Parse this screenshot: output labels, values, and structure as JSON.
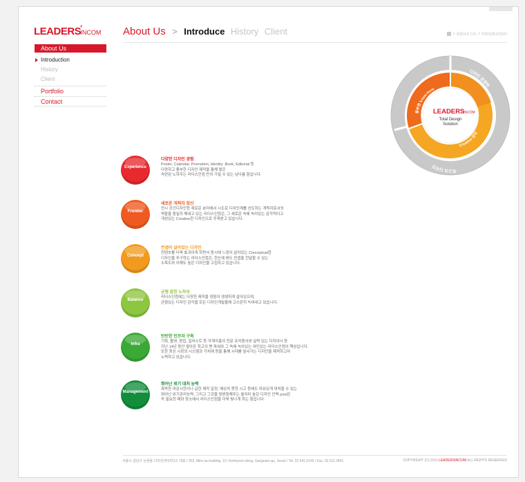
{
  "logo": {
    "main": "LEADERS",
    "sub": "INCOM"
  },
  "sidebar": {
    "about": "About Us",
    "sub_items": [
      {
        "label": "Introduction"
      },
      {
        "label": "History"
      },
      {
        "label": "Client"
      }
    ],
    "main_items": [
      {
        "label": "Portfolio"
      },
      {
        "label": "Contact"
      }
    ]
  },
  "header": {
    "tab_about": "About Us",
    "sep": ">",
    "tab_intro": "Introduce",
    "tab_history": "History",
    "tab_client": "Client",
    "breadcrumb": "> About Us > Introduction"
  },
  "diagram": {
    "brand_main": "LEADERS",
    "brand_sub": "INCOM",
    "center_line1": "Total Design",
    "center_line2": "Solution",
    "outer_top_label": "디자인 경쟁력",
    "outer_bottom_label": "최고의 디자인",
    "inner_left_label": "풍부한 know-how",
    "inner_right_label": "Creative 감각"
  },
  "items": [
    {
      "badge": "Experience",
      "title": "다양한 디자인 경험",
      "lines": [
        "Poster, Calendar, Promotion, Identity ,Book, Editorial 등",
        "다양하고 풍부한 디자인 제작을 통해 쌓은",
        "숙련된 노하우는 리더스인컴 만이 가질 수 있는 남다름 힘입니다."
      ],
      "color": "#e8292e",
      "title_color": "#e8292e"
    },
    {
      "badge": "Frontier",
      "title": "새로운 개척자 정신",
      "lines": [
        "전시 공간디자인등 새로운 분야에서 시도로 디자인계를 선도하는 개척자로서의",
        "역할을 충실히 해내고 있는 리더스인컴은, 그 새로운 속에 녹아있는 감각적이고",
        "개성있는 Creative한 디자인으로 주목받고 있습니다."
      ],
      "color": "#ee5a1f",
      "title_color": "#ee5a1f"
    },
    {
      "badge": "Concept",
      "title": "컨셉이 살아있는 디자인",
      "lines": [
        "컨텐츠를 더욱 효과이게 하면서 동시에 느낌이 살아있는 Conceptual한",
        "디자인을 추구하는 리더스인컴은, 한눈에 봐도 컨셉을 전달할 수 있는",
        "수목도와 이해도 높은 디자인을 고집하고 있습니다."
      ],
      "color": "#f29a1e",
      "title_color": "#f29a1e"
    },
    {
      "badge": "Balance",
      "title": "균형 잡힌 노하우",
      "lines": [
        "리더스인컴에는 다양한 제작을 경험이 생생하게 살아있으며,",
        "균형있는 디자인 감각을 모든 디자인개발을에 고스란히 녹여내고 있습니다."
      ],
      "color": "#8dc63f",
      "title_color": "#8dc63f"
    },
    {
      "badge": "Infra",
      "title": "탄탄한 인프라 구축",
      "lines": [
        "기획, 촬영, 편집, 일러스트 등 각계각층의 전문 프리랜서와 실력 있는 디자이너 등",
        "지난 14년 동안 쌓아온 최고의 맨 파워와 그 속에 녹아있는 여인있는 리더스인컴이 핵심입니다.",
        "또한 최신 시장의 시스템과 가치에 등을 통해 시대를 앞서가는 디자인을 제작하고자",
        "노력하고 있습니다."
      ],
      "color": "#3aa935",
      "title_color": "#3aa935"
    },
    {
      "badge": "Management",
      "title": "뛰어난 위기 대처 능력",
      "lines": [
        "촉박한 마감시한이나 급한 제작 일정, 예상치 못한 시고 등에도 여유있게 대처할 수 있는",
        "뛰어난 위기관리능력, 그리고 그것을 뒷받침해주는 월리티 높은 디자인 인력 pool은",
        "꼭 필요한 때와 장소에서 리더스인컴을 더욱 빛나게 하는 힘입니다."
      ],
      "color": "#138d3b",
      "title_color": "#138d3b"
    }
  ],
  "footer": {
    "address": "서울시 강남구 논현동 디자인(주)리더스 대표 / 303, Mim-na building, 10, Nonhyeon-dong, Gangnam-gu, Seoul / Tel. 02.541.0145 / Fax. 02.511.2841",
    "copyright_prefix": "COPYRIGHT (C) 2011",
    "copyright_brand": "LEADERSINCOM",
    "copyright_suffix": "ALL RIGHTS RESERVED"
  },
  "colors": {
    "brand_red": "#d7182a",
    "ring_outer": "#c6c6c6",
    "ring_inner_orange": "#ee6a1c",
    "ring_inner_yellow": "#f5a623"
  }
}
